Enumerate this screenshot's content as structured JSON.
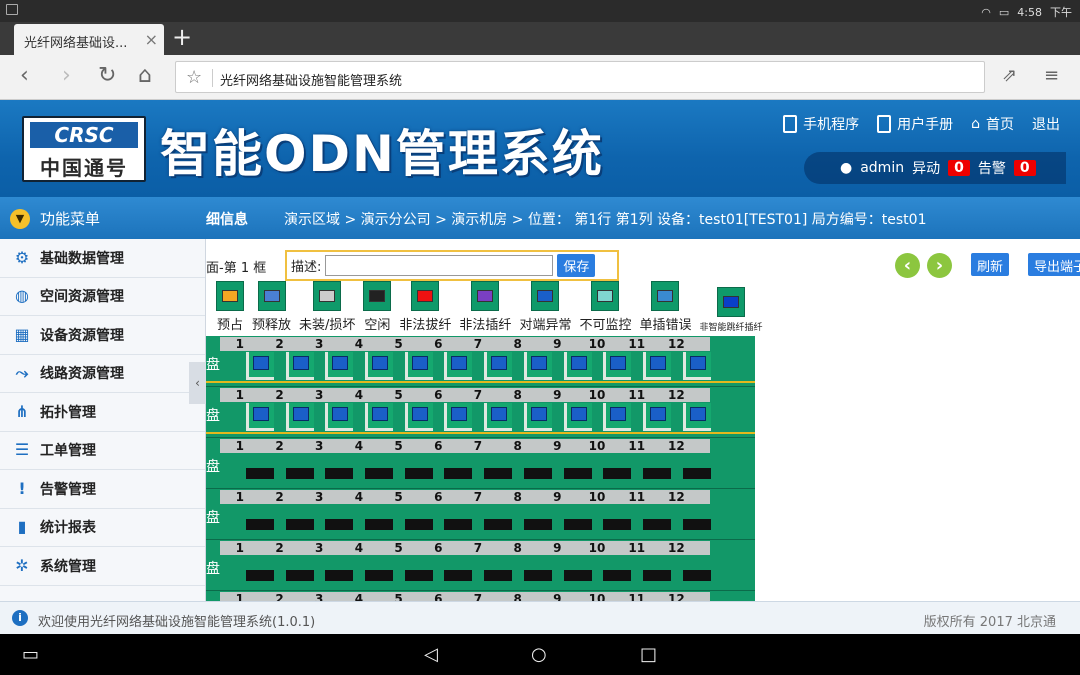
{
  "status": {
    "time": "4:58",
    "ampm": "下午"
  },
  "browser": {
    "tab_title": "光纤网络基础设...",
    "url_text": "光纤网络基础设施智能管理系统"
  },
  "header": {
    "logo_top": "CRSC",
    "logo_bottom": "中国通号",
    "system_title": "智能ODN管理系统",
    "links": [
      "手机程序",
      "用户手册",
      "首页",
      "退出"
    ],
    "user": "admin",
    "abnormal_label": "异动",
    "abnormal_count": "0",
    "alarm_label": "告警",
    "alarm_count": "0"
  },
  "crumbbar": {
    "menu_title": "功能菜单",
    "page_label": "细信息",
    "breadcrumb": "演示区域 > 演示分公司 > 演示机房 > 位置： 第1行 第1列 设备：test01[TEST01] 局方编号：test01"
  },
  "sidebar": {
    "items": [
      {
        "label": "基础数据管理",
        "icon": "gear-icon"
      },
      {
        "label": "空间资源管理",
        "icon": "globe-icon"
      },
      {
        "label": "设备资源管理",
        "icon": "grid-icon"
      },
      {
        "label": "线路资源管理",
        "icon": "route-icon"
      },
      {
        "label": "拓扑管理",
        "icon": "topology-icon"
      },
      {
        "label": "工单管理",
        "icon": "list-icon"
      },
      {
        "label": "告警管理",
        "icon": "alert-icon"
      },
      {
        "label": "统计报表",
        "icon": "chart-icon"
      },
      {
        "label": "系统管理",
        "icon": "settings-icon"
      }
    ]
  },
  "main": {
    "face_label": "面-第 1 框",
    "desc_label": "描述:",
    "desc_value": "",
    "save_label": "保存",
    "refresh_label": "刷新",
    "export_label": "导出端子",
    "legend": [
      {
        "label": "预占",
        "color": "#f5a623"
      },
      {
        "label": "预释放",
        "color": "#4a7fd4"
      },
      {
        "label": "未装/损坏",
        "color": "#cccccc"
      },
      {
        "label": "空闲",
        "color": "#222222"
      },
      {
        "label": "非法拔纤",
        "color": "#ee1111"
      },
      {
        "label": "非法插纤",
        "color": "#7a3fc2"
      },
      {
        "label": "对端异常",
        "color": "#1a5fc8"
      },
      {
        "label": "不可监控",
        "color": "#7fd6d0"
      },
      {
        "label": "单插错误",
        "color": "#3a8ad0"
      },
      {
        "label": "非智能跳纤插纤",
        "color": "#0a3fc8"
      }
    ],
    "port_numbers": [
      "1",
      "2",
      "3",
      "4",
      "5",
      "6",
      "7",
      "8",
      "9",
      "10",
      "11",
      "12"
    ],
    "trays": [
      {
        "label": "盘",
        "state": "connected"
      },
      {
        "label": "盘",
        "state": "connected"
      },
      {
        "label": "盘",
        "state": "empty"
      },
      {
        "label": "盘",
        "state": "empty"
      },
      {
        "label": "盘",
        "state": "empty"
      },
      {
        "label": "",
        "state": "empty"
      }
    ]
  },
  "footer": {
    "welcome": "欢迎使用光纤网络基础设施智能管理系统(1.0.1)",
    "copyright": "版权所有 2017 北京通"
  }
}
